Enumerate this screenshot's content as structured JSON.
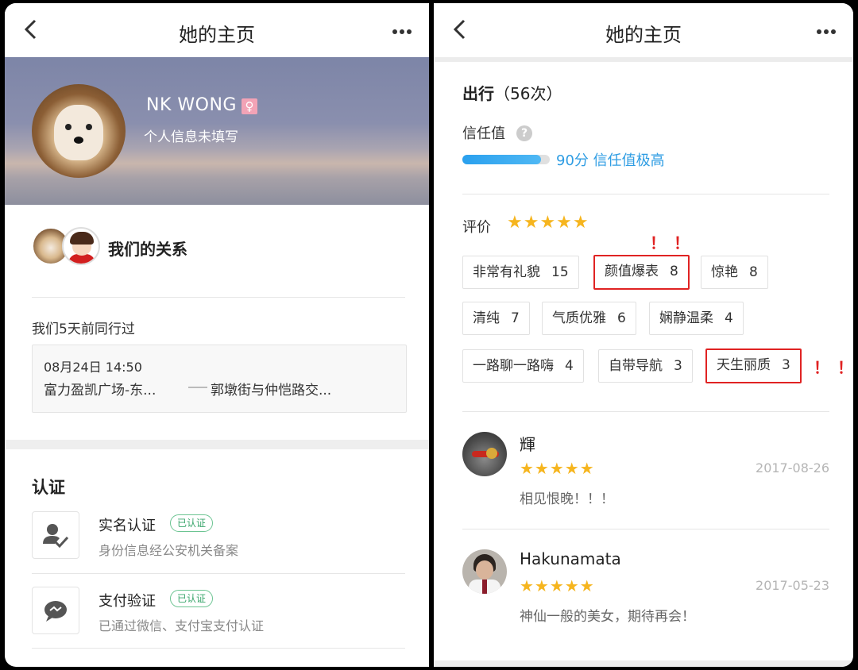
{
  "left": {
    "nav": {
      "title": "她的主页"
    },
    "profile": {
      "name": "NK WONG",
      "gender_symbol": "♀",
      "subtitle": "个人信息未填写"
    },
    "relationship": {
      "title": "我们的关系"
    },
    "trip": {
      "summary": "我们5天前同行过",
      "time": "08月24日 14:50",
      "from": "富力盈凯广场-东...",
      "to": "郭墩街与仲恺路交..."
    },
    "certification": {
      "title": "认证",
      "items": [
        {
          "name": "实名认证",
          "badge": "已认证",
          "desc": "身份信息经公安机关备案",
          "icon": "user-check-icon"
        },
        {
          "name": "支付验证",
          "badge": "已认证",
          "desc": "已通过微信、支付宝支付认证",
          "icon": "wechat-icon"
        }
      ]
    }
  },
  "right": {
    "nav": {
      "title": "她的主页"
    },
    "trips": {
      "label": "出行",
      "count": "（56次）"
    },
    "trust": {
      "label": "信任值",
      "help": "?",
      "score_text": "90分 信任值极高",
      "score_fraction": 0.9
    },
    "rating": {
      "label": "评价",
      "stars": "★★★★★"
    },
    "tags": [
      {
        "label": "非常有礼貌",
        "count": "15",
        "highlight": false
      },
      {
        "label": "颜值爆表",
        "count": "8",
        "highlight": true
      },
      {
        "label": "惊艳",
        "count": "8",
        "highlight": false
      },
      {
        "label": "清纯",
        "count": "7",
        "highlight": false
      },
      {
        "label": "气质优雅",
        "count": "6",
        "highlight": false
      },
      {
        "label": "娴静温柔",
        "count": "4",
        "highlight": false
      },
      {
        "label": "一路聊一路嗨",
        "count": "4",
        "highlight": false
      },
      {
        "label": "自带导航",
        "count": "3",
        "highlight": false
      },
      {
        "label": "天生丽质",
        "count": "3",
        "highlight": true
      }
    ],
    "annotations": {
      "exclaim_top": "！！",
      "exclaim_right": "！！"
    },
    "reviews": [
      {
        "name": "輝",
        "stars": "★★★★★",
        "date": "2017-08-26",
        "text": "相见恨晚！！！"
      },
      {
        "name": "Hakunamata",
        "stars": "★★★★★",
        "date": "2017-05-23",
        "text": "神仙一般的美女，期待再会！"
      }
    ]
  }
}
